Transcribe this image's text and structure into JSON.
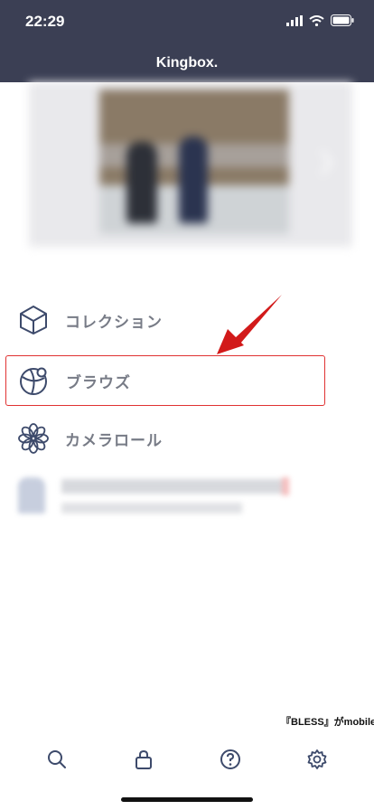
{
  "status_bar": {
    "time": "22:29"
  },
  "header": {
    "title": "Kingbox."
  },
  "menu": {
    "items": [
      {
        "label": "コレクション",
        "icon": "cube-icon"
      },
      {
        "label": "ブラウズ",
        "icon": "globe-icon"
      },
      {
        "label": "カメラロール",
        "icon": "flower-icon"
      }
    ]
  },
  "overlay_text": "『BLESS』がmobileで",
  "tabbar": {
    "items": [
      {
        "icon": "search-icon"
      },
      {
        "icon": "lock-icon"
      },
      {
        "icon": "help-icon"
      },
      {
        "icon": "gear-icon"
      }
    ]
  },
  "colors": {
    "header_bg": "#3b3f54",
    "label": "#777b86",
    "icon_stroke": "#3d4a6b",
    "highlight": "#e03232"
  }
}
